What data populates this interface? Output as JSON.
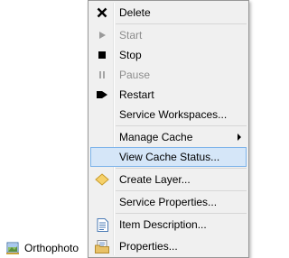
{
  "tree": {
    "layer_label": "Orthophoto"
  },
  "menu": {
    "items": [
      {
        "label": "Delete",
        "icon": "delete-x-icon",
        "disabled": false
      },
      {
        "label": "Start",
        "icon": "play-icon",
        "disabled": true
      },
      {
        "label": "Stop",
        "icon": "stop-icon",
        "disabled": false
      },
      {
        "label": "Pause",
        "icon": "pause-icon",
        "disabled": true
      },
      {
        "label": "Restart",
        "icon": "restart-icon",
        "disabled": false
      },
      {
        "label": "Service Workspaces...",
        "icon": "",
        "disabled": false
      },
      {
        "label": "Manage Cache",
        "icon": "",
        "disabled": false,
        "submenu": true
      },
      {
        "label": "View Cache Status...",
        "icon": "",
        "disabled": false,
        "highlighted": true
      },
      {
        "label": "Create Layer...",
        "icon": "layer-diamond-icon",
        "disabled": false
      },
      {
        "label": "Service Properties...",
        "icon": "",
        "disabled": false
      },
      {
        "label": "Item Description...",
        "icon": "document-icon",
        "disabled": false
      },
      {
        "label": "Properties...",
        "icon": "properties-folder-icon",
        "disabled": false
      }
    ]
  },
  "colors": {
    "highlight_fill": "#d5e6f8",
    "highlight_border": "#7eb4ea",
    "menu_bg": "#f0f0f0"
  }
}
